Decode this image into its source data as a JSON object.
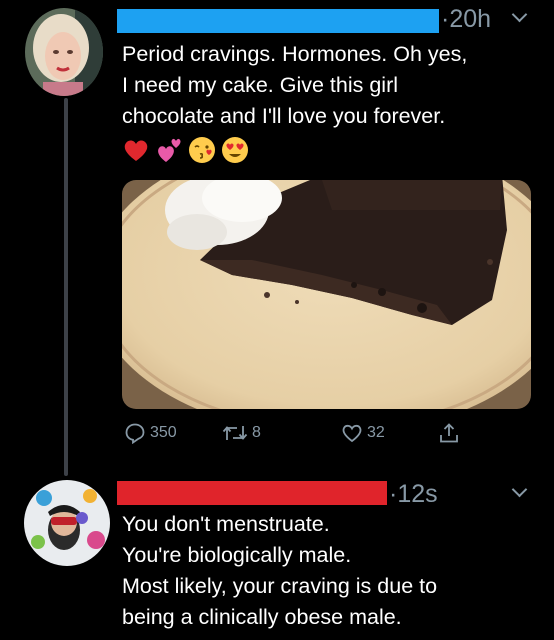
{
  "tweet1": {
    "time": "20h",
    "text_lines": [
      "Period cravings. Hormones. Oh yes,",
      "I need my cake. Give this girl",
      "chocolate and I'll love you forever."
    ],
    "emojis": [
      "red-heart-emoji",
      "two-hearts-emoji",
      "kissing-face-emoji",
      "heart-eyes-emoji"
    ],
    "media": "chocolate-cake-photo",
    "actions": {
      "replies": "350",
      "retweets": "8",
      "likes": "32"
    }
  },
  "tweet2": {
    "time": "12s",
    "text_lines": [
      "You don't menstruate.",
      "You're biologically male.",
      "Most likely, your craving is due to",
      "being a clinically obese male."
    ]
  },
  "colors": {
    "background": "#000000",
    "name_redaction_1": "#1da1f2",
    "name_redaction_2": "#e0242b",
    "muted": "#8899a6",
    "thread_line": "#3d4148"
  }
}
